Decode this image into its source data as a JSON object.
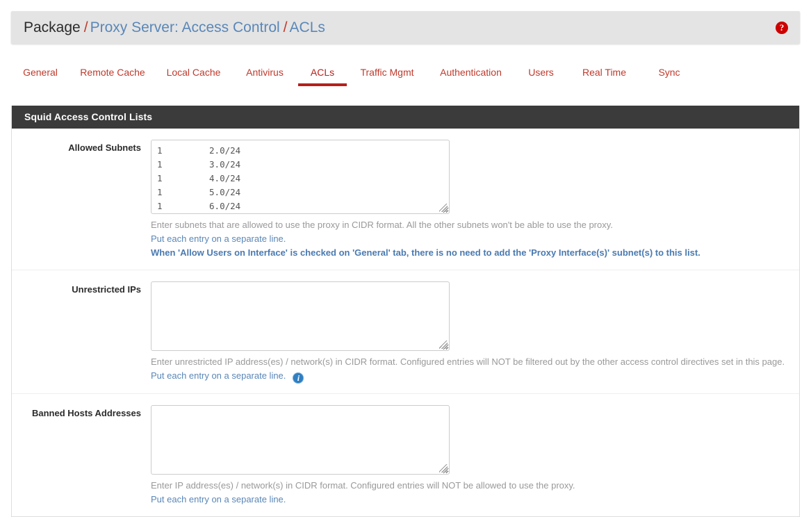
{
  "breadcrumb": {
    "root": "Package",
    "separator": "/",
    "section": "Proxy Server: Access Control",
    "page": "ACLs",
    "help_icon_glyph": "?"
  },
  "tabs": [
    {
      "label": "General",
      "active": false
    },
    {
      "label": "Remote Cache",
      "active": false
    },
    {
      "label": "Local Cache",
      "active": false
    },
    {
      "label": "Antivirus",
      "active": false
    },
    {
      "label": "ACLs",
      "active": true
    },
    {
      "label": "Traffic Mgmt",
      "active": false
    },
    {
      "label": "Authentication",
      "active": false
    },
    {
      "label": "Users",
      "active": false
    },
    {
      "label": "Real Time",
      "active": false
    },
    {
      "label": "Sync",
      "active": false
    }
  ],
  "panel": {
    "title": "Squid Access Control Lists",
    "rows": [
      {
        "label": "Allowed Subnets",
        "value_lines": [
          {
            "prefix": "1",
            "redacted": true,
            "suffix": "2.0/24"
          },
          {
            "prefix": "1",
            "redacted": true,
            "suffix": "3.0/24"
          },
          {
            "prefix": "1",
            "redacted": true,
            "suffix": "4.0/24"
          },
          {
            "prefix": "1",
            "redacted": true,
            "suffix": "5.0/24"
          },
          {
            "prefix": "1",
            "redacted": true,
            "suffix": "6.0/24"
          }
        ],
        "help": [
          {
            "text": "Enter subnets that are allowed to use the proxy in CIDR format. All the other subnets won't be able to use the proxy.",
            "style": "grey"
          },
          {
            "text": "Put each entry on a separate line.",
            "style": "blue"
          },
          {
            "text": "When 'Allow Users on Interface' is checked on 'General' tab, there is no need to add the 'Proxy Interface(s)' subnet(s) to this list.",
            "style": "blue-bold"
          }
        ],
        "info_icon": false
      },
      {
        "label": "Unrestricted IPs",
        "value_lines": [],
        "help": [
          {
            "text": "Enter unrestricted IP address(es) / network(s) in CIDR format. Configured entries will NOT be filtered out by the other access control directives set in this page.",
            "style": "grey"
          },
          {
            "text": "Put each entry on a separate line.",
            "style": "blue"
          }
        ],
        "info_icon": true,
        "info_icon_glyph": "i"
      },
      {
        "label": "Banned Hosts Addresses",
        "value_lines": [],
        "help": [
          {
            "text": "Enter IP address(es) / network(s) in CIDR format. Configured entries will NOT be allowed to use the proxy.",
            "style": "grey"
          },
          {
            "text": "Put each entry on a separate line.",
            "style": "blue"
          }
        ],
        "info_icon": false
      }
    ]
  },
  "colors": {
    "accent_red": "#b5201b",
    "tab_red": "#c0392b",
    "link_blue": "#5a87b8",
    "panel_header_bg": "#3b3b3b",
    "breadcrumb_bg": "#e4e4e4",
    "help_icon_bg": "#cc0000",
    "info_icon_bg": "#2f7fc1"
  }
}
